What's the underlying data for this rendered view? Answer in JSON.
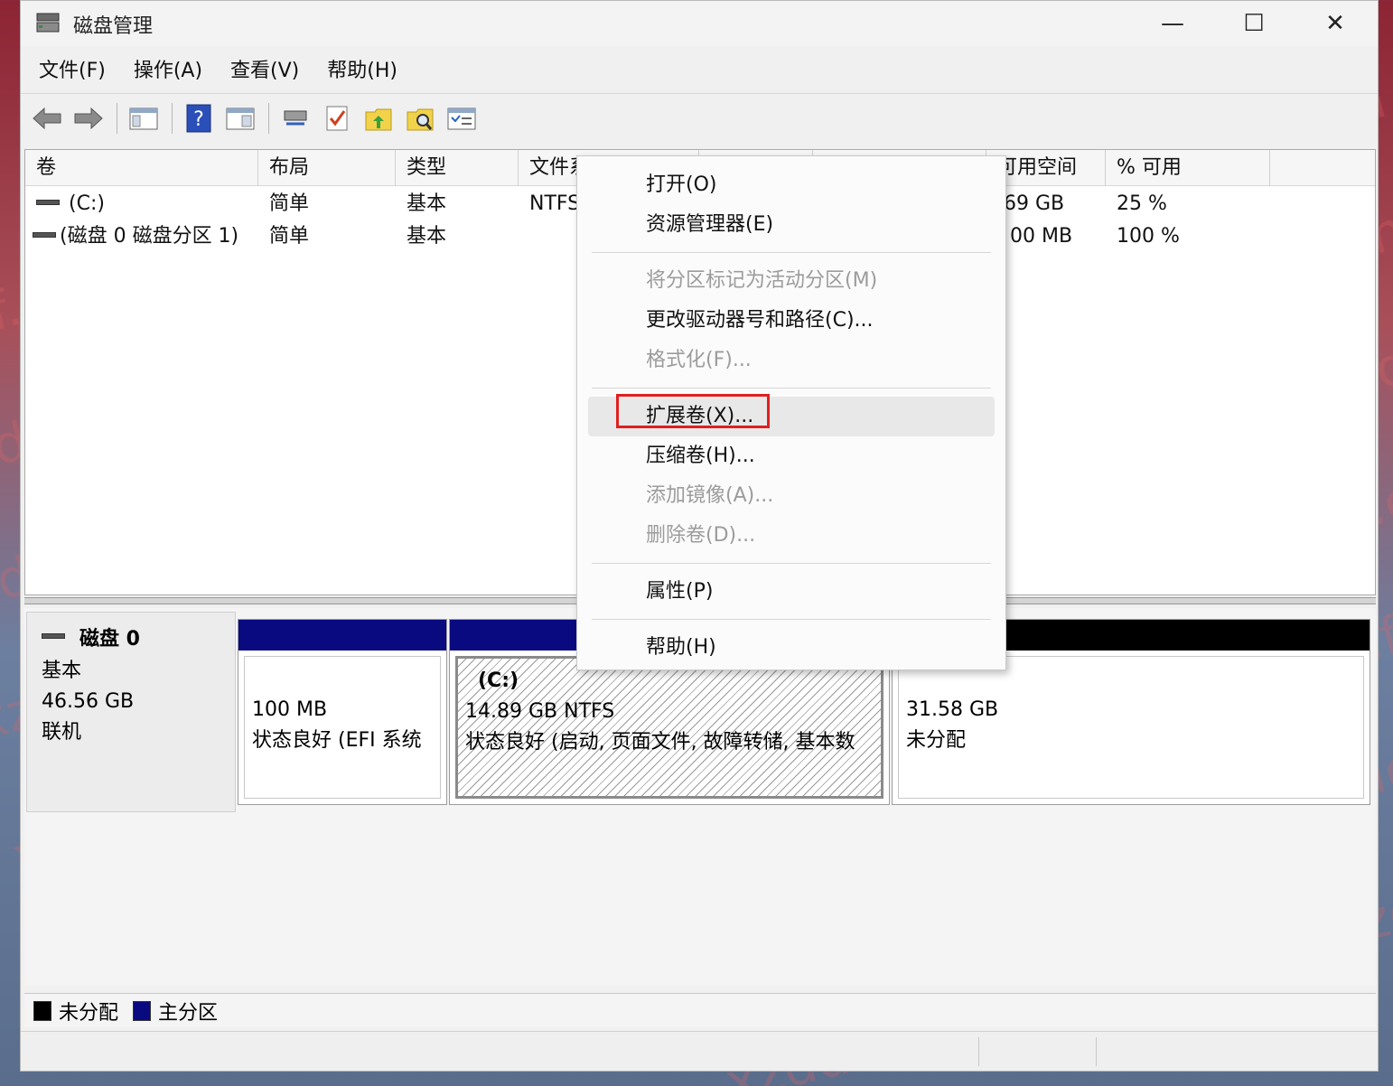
{
  "window": {
    "title": "磁盘管理",
    "controls": {
      "minimize": "—",
      "maximize": "☐",
      "close": "✕"
    }
  },
  "menubar": {
    "items": [
      "文件(F)",
      "操作(A)",
      "查看(V)",
      "帮助(H)"
    ]
  },
  "toolbar": {
    "buttons": [
      "back-icon",
      "forward-icon",
      "console-tree-icon",
      "help-icon",
      "show-hide-pane-icon",
      "connect-icon",
      "check-icon",
      "up-folder-icon",
      "search-folder-icon",
      "properties-list-icon"
    ]
  },
  "volume_list": {
    "columns": [
      "卷",
      "布局",
      "类型",
      "文件系",
      "",
      "",
      "可用空间",
      "% 可用"
    ],
    "rows": [
      {
        "volume": "(C:)",
        "layout": "简单",
        "type": "基本",
        "fs": "NTFS",
        "free": ".69 GB",
        "pct": "25 %"
      },
      {
        "volume": "(磁盘 0 磁盘分区 1)",
        "layout": "简单",
        "type": "基本",
        "fs": "",
        "free": "00 MB",
        "pct": "100 %"
      }
    ]
  },
  "disk": {
    "name": "磁盘 0",
    "kind": "基本",
    "size": "46.56 GB",
    "state": "联机",
    "partitions": [
      {
        "title": "",
        "line1": "100 MB",
        "line2": "状态良好 (EFI 系统",
        "bar_color": "#0a0a80"
      },
      {
        "title": "(C:)",
        "line1": "14.89 GB NTFS",
        "line2": "状态良好 (启动, 页面文件, 故障转储, 基本数",
        "bar_color": "#0a0a80"
      },
      {
        "title": "",
        "line1": "31.58 GB",
        "line2": "未分配",
        "bar_color": "#000000"
      }
    ]
  },
  "legend": {
    "items": [
      {
        "label": "未分配",
        "color": "#000000"
      },
      {
        "label": "主分区",
        "color": "#0a0a80"
      }
    ]
  },
  "context_menu": {
    "items": [
      {
        "label": "打开(O)",
        "enabled": true
      },
      {
        "label": "资源管理器(E)",
        "enabled": true
      },
      {
        "label": "将分区标记为活动分区(M)",
        "enabled": false
      },
      {
        "label": "更改驱动器号和路径(C)...",
        "enabled": true
      },
      {
        "label": "格式化(F)...",
        "enabled": false
      },
      {
        "label": "扩展卷(X)...",
        "enabled": true,
        "highlighted": true
      },
      {
        "label": "压缩卷(H)...",
        "enabled": true
      },
      {
        "label": "添加镜像(A)...",
        "enabled": false
      },
      {
        "label": "删除卷(D)...",
        "enabled": false
      },
      {
        "label": "属性(P)",
        "enabled": true
      },
      {
        "label": "帮助(H)",
        "enabled": true
      }
    ]
  },
  "watermark": "xzddf.com",
  "colors": {
    "primary_partition": "#0a0a80",
    "unallocated": "#000000",
    "highlight_box": "#e02020"
  }
}
